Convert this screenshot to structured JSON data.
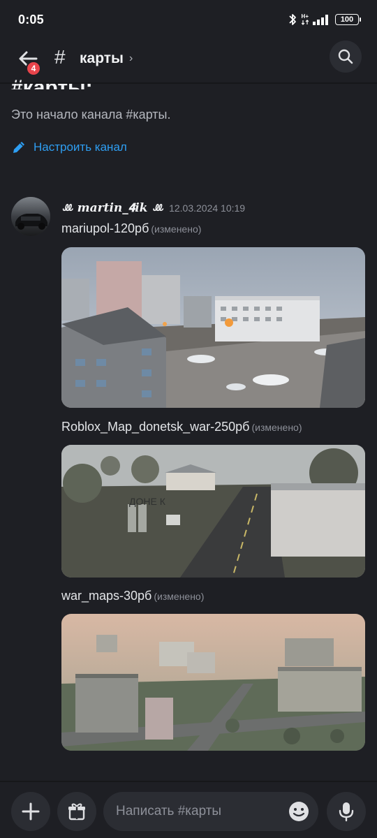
{
  "status_bar": {
    "time": "0:05",
    "network_label": "H+",
    "battery": "100"
  },
  "header": {
    "back_badge": "4",
    "hash": "#",
    "channel_name": "карты",
    "chevron": "›"
  },
  "intro": {
    "heading": "#карты:",
    "text": "Это начало канала #карты.",
    "setup_link": "Настроить канал"
  },
  "message": {
    "username": "ꔛ 𝒎𝒂𝒓𝒕𝒊𝒏_𝟒𝒊𝒌 ꔛ",
    "timestamp": "12.03.2024 10:19",
    "items": [
      {
        "title": "mariupol-120рб",
        "edited": "(изменено)"
      },
      {
        "title": "Roblox_Map_donetsk_war-250рб",
        "edited": "(изменено)"
      },
      {
        "title": "war_maps-30рб",
        "edited": "(изменено)"
      }
    ],
    "image_sign_text": "ДОНЕ К"
  },
  "composer": {
    "placeholder": "Написать #карты"
  },
  "colors": {
    "background": "#1e1f24",
    "link": "#2e9ef2",
    "badge": "#e8444b",
    "surface": "#2b2d33"
  },
  "icons": {
    "back": "arrow-left-icon",
    "search": "search-icon",
    "edit": "pencil-icon",
    "add": "plus-icon",
    "gift": "gift-icon",
    "emoji": "smile-icon",
    "mic": "microphone-icon"
  }
}
